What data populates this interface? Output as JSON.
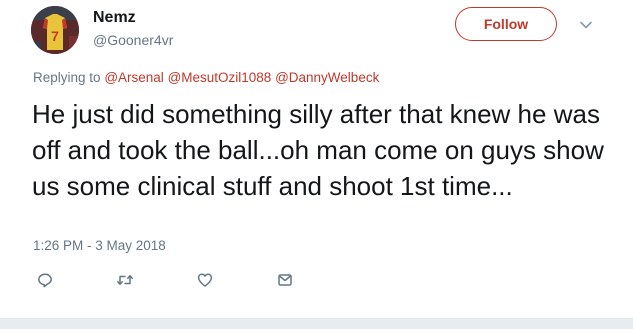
{
  "user": {
    "display_name": "Nemz",
    "handle": "@Gooner4vr",
    "avatar_icon": "jersey-number-7-avatar"
  },
  "follow_button": {
    "label": "Follow",
    "color": "#c0392b"
  },
  "menu_icon": "chevron-down-icon",
  "reply_context": {
    "prefix": "Replying to",
    "mentions": [
      "@Arsenal",
      "@MesutOzil1088",
      "@DannyWelbeck"
    ]
  },
  "tweet": {
    "text": "He just did something silly after that knew he was off and took the ball...oh man come on guys show us some clinical stuff and shoot 1st time...",
    "timestamp": "1:26 PM - 3 May 2018"
  },
  "actions": [
    {
      "name": "reply",
      "icon": "reply-icon"
    },
    {
      "name": "retweet",
      "icon": "retweet-icon"
    },
    {
      "name": "like",
      "icon": "heart-icon"
    },
    {
      "name": "direct-message",
      "icon": "envelope-icon"
    }
  ],
  "colors": {
    "accent": "#c0392b",
    "muted_text": "#657786",
    "primary_text": "#14171a",
    "footer_bg": "#e6ecf0"
  }
}
